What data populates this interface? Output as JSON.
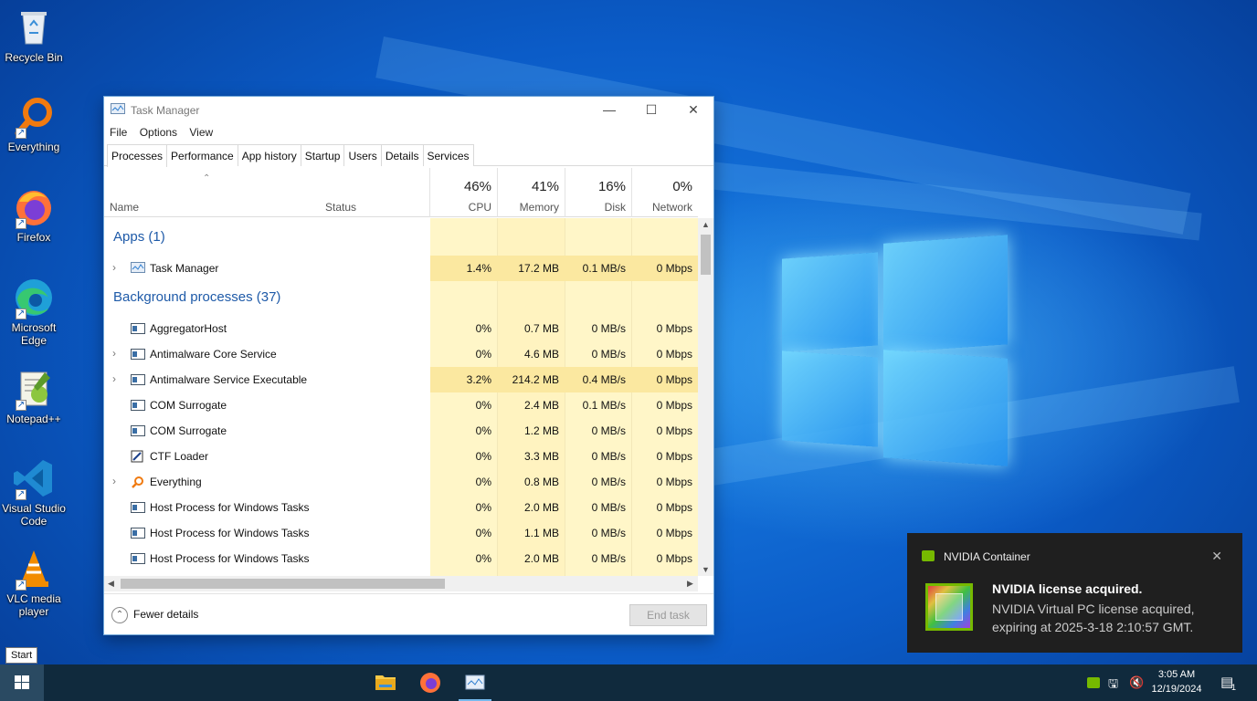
{
  "desktop": {
    "icons": [
      {
        "label": "Recycle Bin"
      },
      {
        "label": "Everything"
      },
      {
        "label": "Firefox"
      },
      {
        "label": "Microsoft Edge"
      },
      {
        "label": "Notepad++"
      },
      {
        "label": "Visual Studio Code"
      },
      {
        "label": "VLC media player"
      }
    ]
  },
  "task_manager": {
    "title": "Task Manager",
    "menu": [
      "File",
      "Options",
      "View"
    ],
    "tabs": [
      "Processes",
      "Performance",
      "App history",
      "Startup",
      "Users",
      "Details",
      "Services"
    ],
    "active_tab": "Processes",
    "columns": {
      "name": "Name",
      "status": "Status",
      "cpu": {
        "pct": "46%",
        "label": "CPU"
      },
      "memory": {
        "pct": "41%",
        "label": "Memory"
      },
      "disk": {
        "pct": "16%",
        "label": "Disk"
      },
      "network": {
        "pct": "0%",
        "label": "Network"
      }
    },
    "groups": {
      "apps": "Apps (1)",
      "background": "Background processes (37)"
    },
    "apps": [
      {
        "name": "Task Manager",
        "cpu": "1.4%",
        "memory": "17.2 MB",
        "disk": "0.1 MB/s",
        "network": "0 Mbps"
      }
    ],
    "background": [
      {
        "name": "AggregatorHost",
        "cpu": "0%",
        "memory": "0.7 MB",
        "disk": "0 MB/s",
        "network": "0 Mbps"
      },
      {
        "name": "Antimalware Core Service",
        "cpu": "0%",
        "memory": "4.6 MB",
        "disk": "0 MB/s",
        "network": "0 Mbps"
      },
      {
        "name": "Antimalware Service Executable",
        "cpu": "3.2%",
        "memory": "214.2 MB",
        "disk": "0.4 MB/s",
        "network": "0 Mbps"
      },
      {
        "name": "COM Surrogate",
        "cpu": "0%",
        "memory": "2.4 MB",
        "disk": "0.1 MB/s",
        "network": "0 Mbps"
      },
      {
        "name": "COM Surrogate",
        "cpu": "0%",
        "memory": "1.2 MB",
        "disk": "0 MB/s",
        "network": "0 Mbps"
      },
      {
        "name": "CTF Loader",
        "cpu": "0%",
        "memory": "3.3 MB",
        "disk": "0 MB/s",
        "network": "0 Mbps"
      },
      {
        "name": "Everything",
        "cpu": "0%",
        "memory": "0.8 MB",
        "disk": "0 MB/s",
        "network": "0 Mbps"
      },
      {
        "name": "Host Process for Windows Tasks",
        "cpu": "0%",
        "memory": "2.0 MB",
        "disk": "0 MB/s",
        "network": "0 Mbps"
      },
      {
        "name": "Host Process for Windows Tasks",
        "cpu": "0%",
        "memory": "1.1 MB",
        "disk": "0 MB/s",
        "network": "0 Mbps"
      },
      {
        "name": "Host Process for Windows Tasks",
        "cpu": "0%",
        "memory": "2.0 MB",
        "disk": "0 MB/s",
        "network": "0 Mbps"
      }
    ],
    "footer": {
      "fewer_details": "Fewer details",
      "end_task": "End task"
    }
  },
  "notification": {
    "app": "NVIDIA Container",
    "title": "NVIDIA license acquired.",
    "body": "NVIDIA Virtual PC license acquired, expiring at 2025-3-18 2:10:57 GMT."
  },
  "start_tooltip": "Start",
  "taskbar": {
    "time": "3:05 AM",
    "date": "12/19/2024",
    "notification_count": "1"
  },
  "colors": {
    "accent": "#1e5aa8",
    "heat_light": "#fff8d6",
    "heat_mid": "#fdefb2",
    "taskbar": "#102a3d",
    "nvidia_green": "#76b900"
  }
}
